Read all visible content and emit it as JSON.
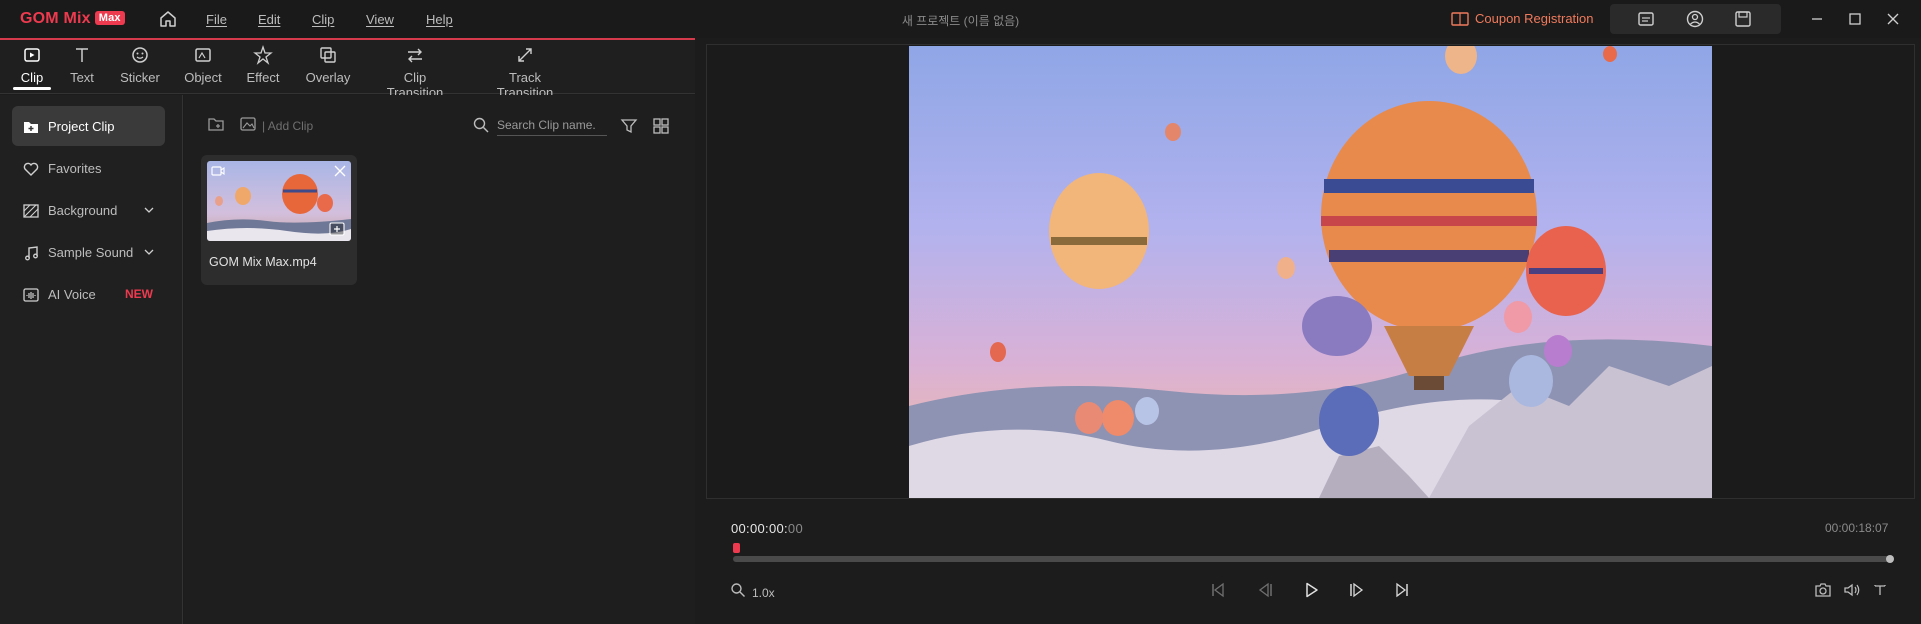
{
  "app": {
    "logo_text": "GOM Mix",
    "logo_badge": "Max",
    "window_title": "새 프로젝트 (이름 없음)"
  },
  "menu": [
    {
      "label": "File"
    },
    {
      "label": "Edit"
    },
    {
      "label": "Clip"
    },
    {
      "label": "View"
    },
    {
      "label": "Help"
    }
  ],
  "coupon_label": "Coupon Registration",
  "tabs": [
    {
      "label": "Clip",
      "icon": "clip-icon"
    },
    {
      "label": "Text",
      "icon": "text-icon"
    },
    {
      "label": "Sticker",
      "icon": "sticker-icon"
    },
    {
      "label": "Object",
      "icon": "object-icon"
    },
    {
      "label": "Effect",
      "icon": "effect-icon"
    },
    {
      "label": "Overlay",
      "icon": "overlay-icon"
    },
    {
      "label": "Clip Transition",
      "icon": "clip-transition-icon"
    },
    {
      "label": "Track Transition",
      "icon": "track-transition-icon"
    }
  ],
  "sidebar": {
    "items": [
      {
        "label": "Project Clip"
      },
      {
        "label": "Favorites"
      },
      {
        "label": "Background"
      },
      {
        "label": "Sample Sound"
      },
      {
        "label": "AI Voice",
        "badge": "NEW"
      }
    ]
  },
  "clips": {
    "add_label": "| Add Clip",
    "search_placeholder": "Search Clip name.",
    "items": [
      {
        "name": "GOM Mix Max.mp4"
      }
    ]
  },
  "player": {
    "timecode_main": "00:00:00:",
    "timecode_frames": "00",
    "duration": "00:00:18:07",
    "zoom": "1.0x",
    "progress": 0.0
  },
  "colors": {
    "accent": "#ee3a4f",
    "coupon": "#f07a5c"
  }
}
